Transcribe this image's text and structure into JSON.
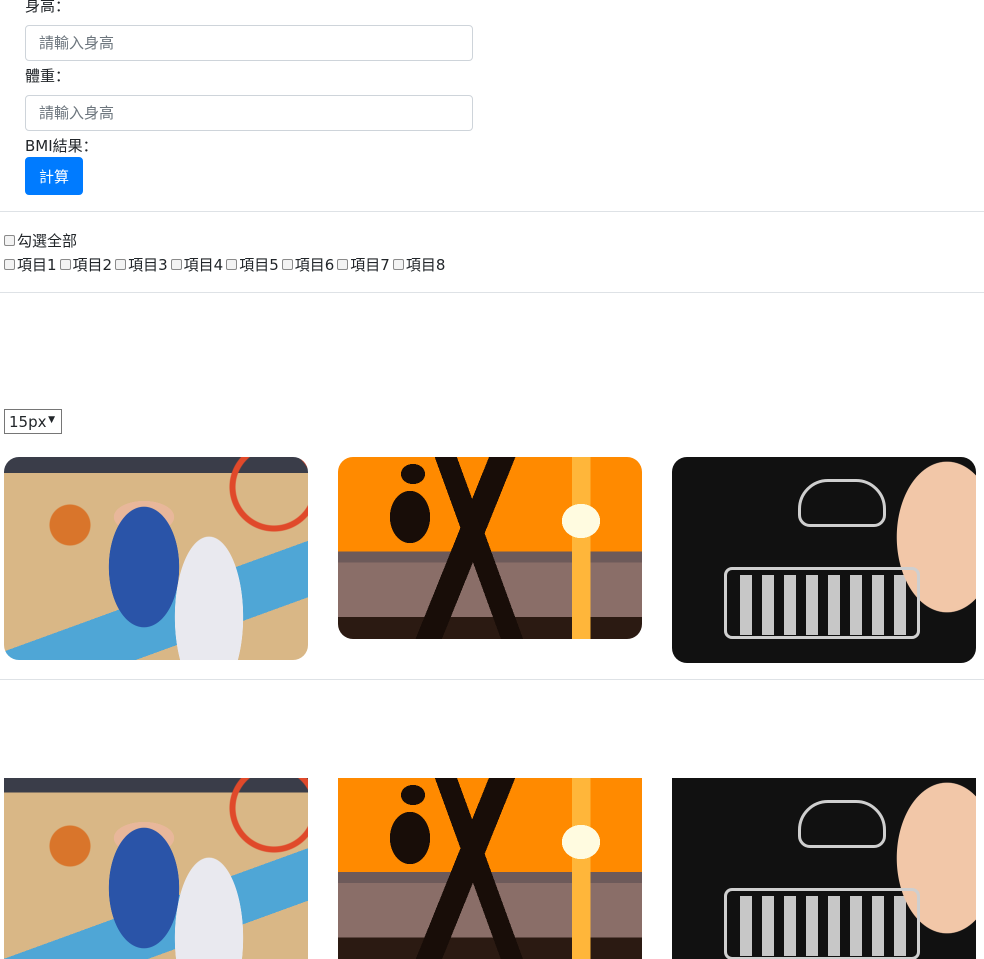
{
  "bmi_form": {
    "height_label": "身高：",
    "height_placeholder": "請輸入身高",
    "weight_label": "體重：",
    "weight_placeholder": "請輸入身高",
    "result_label": "BMI結果：",
    "calc_button": "計算"
  },
  "checkbox_group": {
    "select_all_label": "勾選全部",
    "items": [
      "項目1",
      "項目2",
      "項目3",
      "項目4",
      "項目5",
      "項目6",
      "項目7",
      "項目8"
    ]
  },
  "radius_select": {
    "selected": "15px"
  },
  "gallery": {
    "images": [
      "basketball-photo",
      "runner-sunset-photo",
      "chalk-keyboard-photo"
    ]
  }
}
